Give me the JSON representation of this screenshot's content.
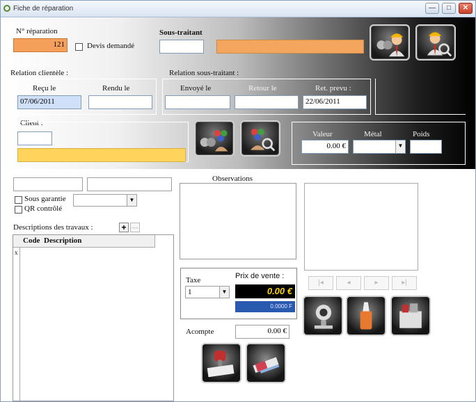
{
  "window": {
    "title": "Fiche de réparation",
    "minimize": "—",
    "maximize": "□",
    "close": "✕"
  },
  "header": {
    "reparation_label": "N° réparation",
    "reparation_value": "121",
    "devis_label": "Devis demandé",
    "sous_traitant_label": "Sous-traitant",
    "sous_traitant_value": ""
  },
  "relation_client": {
    "title": "Relation clientèle :",
    "recu_label": "Reçu le",
    "recu_value": "07/06/2011",
    "rendu_label": "Rendu le",
    "rendu_value": ""
  },
  "relation_sous_traitant": {
    "title": "Relation sous-traitant :",
    "envoye_label": "Envoyé le",
    "envoye_value": "",
    "retour_label": "Retour le",
    "retour_value": "",
    "ret_prevu_label": "Ret. prevu :",
    "ret_prevu_value": "22/06/2011"
  },
  "client": {
    "label": "Client :",
    "value": ""
  },
  "valeur": {
    "valeur_label": "Valeur",
    "valeur_value": "0.00 €",
    "metal_label": "Métal",
    "metal_value": "",
    "poids_label": "Poids",
    "poids_value": ""
  },
  "lower": {
    "sous_garantie_label": "Sous garantie",
    "qr_label": "QR contrôlé",
    "descriptions_label": "Descriptions des travaux :",
    "add_label": "+",
    "remove_label": "—",
    "grid_columns": [
      "Code",
      "Description"
    ],
    "grid_row_marker": "x",
    "observations_label": "Observations",
    "nav": [
      "|◂",
      "◂",
      "▸",
      "▸|"
    ]
  },
  "pricing": {
    "taxe_label": "Taxe",
    "taxe_value": "1",
    "prix_label": "Prix de vente :",
    "prix_value": "0.00 €",
    "prix_francs": "0.0000 F",
    "acompte_label": "Acompte",
    "acompte_value": "0.00 €"
  },
  "colors": {
    "orange": "#f4a55e",
    "yellow": "#ffd45a",
    "price_text": "#ffd400",
    "blue": "#2a5ab0"
  }
}
